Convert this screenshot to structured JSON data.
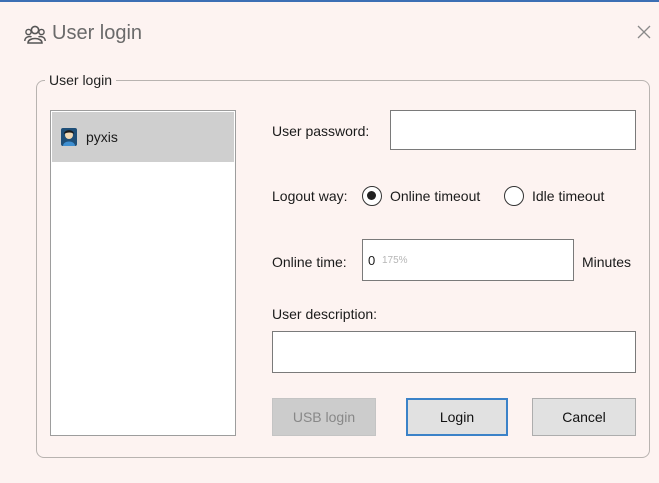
{
  "window": {
    "title": "User login",
    "title_icon": "users-icon",
    "close_icon": "close-icon"
  },
  "group": {
    "legend": "User login"
  },
  "users": [
    {
      "name": "pyxis",
      "icon": "user-avatar-icon",
      "selected": true
    }
  ],
  "form": {
    "password_label": "User password:",
    "password_value": "",
    "logout_label": "Logout way:",
    "logout_options": [
      {
        "label": "Online timeout",
        "checked": true
      },
      {
        "label": "Idle timeout",
        "checked": false
      }
    ],
    "online_time_label": "Online time:",
    "online_time_value": "0",
    "online_time_ghost": "175%",
    "online_time_unit": "Minutes",
    "description_label": "User description:",
    "description_value": ""
  },
  "buttons": {
    "usb_login": "USB login",
    "login": "Login",
    "cancel": "Cancel"
  },
  "colors": {
    "accent": "#3b82c8",
    "background": "#fdf3f1",
    "selection": "#cfcfcf"
  }
}
